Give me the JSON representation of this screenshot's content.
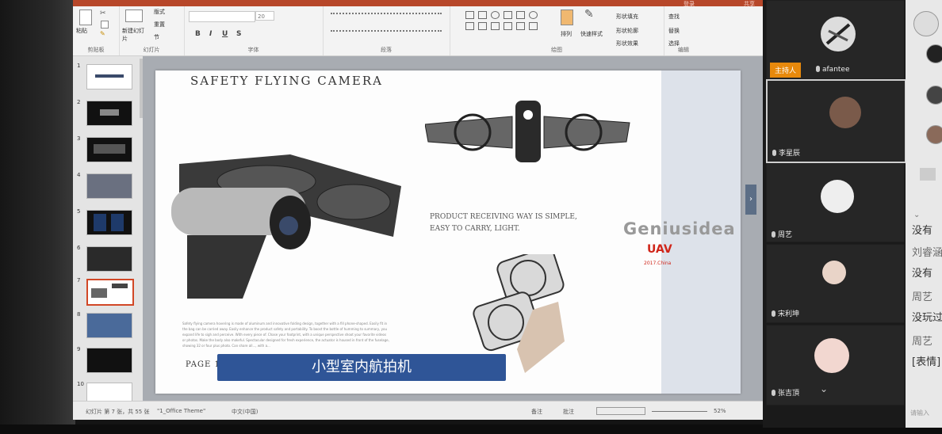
{
  "powerpoint": {
    "account": "登录",
    "share": "共享",
    "ribbon": {
      "clipboard": {
        "paste": "粘贴",
        "label": "剪贴板"
      },
      "slides": {
        "new_slide": "新建幻灯片",
        "layout": "版式",
        "reset": "重置",
        "section": "节",
        "label": "幻灯片"
      },
      "font": {
        "size": "20",
        "bold": "B",
        "italic": "I",
        "underline": "U",
        "strike": "S",
        "label": "字体"
      },
      "paragraph": {
        "label": "段落"
      },
      "drawing": {
        "arrange": "排列",
        "quick_styles": "快速样式",
        "fill": "形状填充",
        "outline": "形状轮廓",
        "effects": "形状效果",
        "label": "绘图"
      },
      "editing": {
        "find": "查找",
        "replace": "替换",
        "select": "选择",
        "label": "编辑"
      }
    },
    "thumbnails": [
      "1",
      "2",
      "3",
      "4",
      "5",
      "6",
      "7",
      "8",
      "9",
      "10"
    ],
    "slide": {
      "title": "SAFETY FLYING CAMERA",
      "product_line1": "PRODUCT RECEIVING WAY IS SIMPLE,",
      "product_line2": "EASY TO CARRY, LIGHT.",
      "brand": "Geniusidea",
      "uav": "UAV",
      "uav_sub": "2017.China",
      "paragraph": "Safety flying camera hovering is made of aluminum and innovative folding design, together with a fill phone-shaped. Easily fit in the bag can be carried away. Easily enhance the product safety and portability. To boost the bottle of humming to summary, you expand life to sigh and perceive. With every piece of. Chase your footprint, with a unique perspective shoot your favorite videos or photos. Make the body also makeful. Spectacular designed for fresh experience, the actuator is housed in front of the fuselage, showing 32 or four plus photo. Can share all..., with a...",
      "page_label": "PAGE 1",
      "caption": "小型室内航拍机"
    },
    "status": {
      "slide_info": "幻灯片 第 7 张，共 55 张",
      "theme": "\"1_Office Theme\"",
      "lang": "中文(中国)",
      "notes": "备注",
      "comments": "批注",
      "zoom": "52%"
    }
  },
  "meeting": {
    "host_badge": "主持人",
    "participants": [
      {
        "name": "afantee"
      },
      {
        "name": "李星辰"
      },
      {
        "name": "周艺"
      },
      {
        "name": "宋利坤"
      },
      {
        "name": "张吉頂"
      }
    ]
  },
  "chat": {
    "lines": [
      {
        "text": "没有",
        "kind": "msg"
      },
      {
        "text": "刘睿涵",
        "kind": "name"
      },
      {
        "text": "没有",
        "kind": "msg"
      },
      {
        "text": "周艺",
        "kind": "name"
      },
      {
        "text": "没玩过",
        "kind": "msg"
      },
      {
        "text": "周艺",
        "kind": "name"
      },
      {
        "text": "[表情]",
        "kind": "msg"
      }
    ],
    "input_placeholder": "请输入"
  }
}
